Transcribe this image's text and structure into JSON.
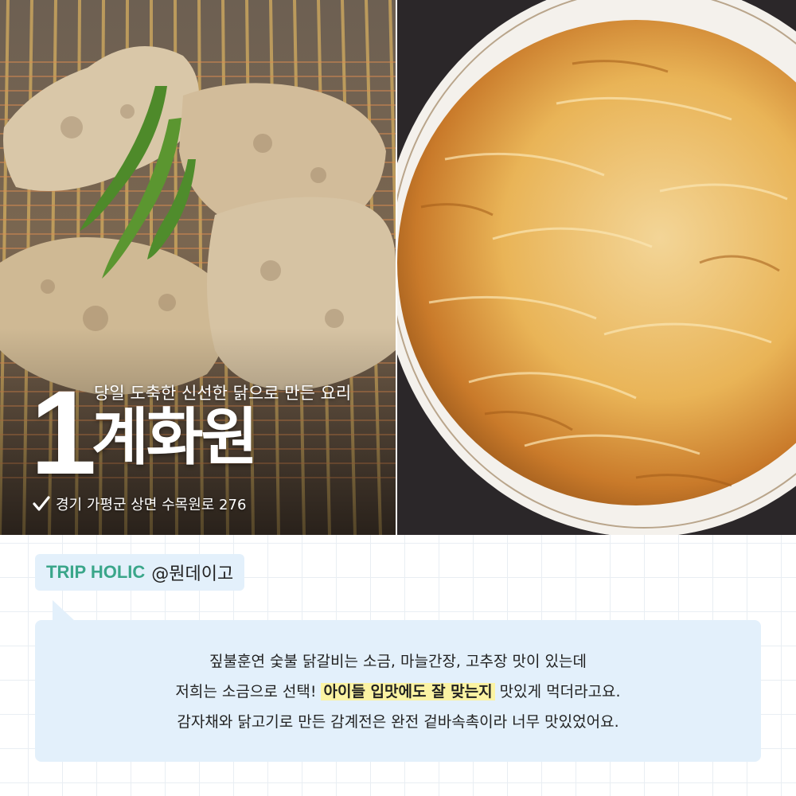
{
  "feature": {
    "rank": "1",
    "tagline": "당일 도축한 신선한 닭으로 만든 요리",
    "name": "계화원",
    "address": "경기 가평군 상면 수목원로 276",
    "icons": {
      "address": "check-icon"
    }
  },
  "review": {
    "brand": "TRIP HOLIC",
    "author": "@뭔데이고",
    "line1": "짚불훈연 숯불 닭갈비는 소금, 마늘간장, 고추장 맛이 있는데",
    "line2_before": "저희는 소금으로 선택! ",
    "line2_highlight": "아이들 입맛에도 잘 맞는지",
    "line2_after": " 맛있게 먹더라고요.",
    "line3": "감자채와 닭고기로 만든 감계전은 완전 겉바속촉이라 너무 맛있었어요."
  },
  "colors": {
    "brand": "#3aa68a",
    "bubble": "#e3f0fb",
    "highlight": "#fbf3a3",
    "text": "#222222"
  }
}
